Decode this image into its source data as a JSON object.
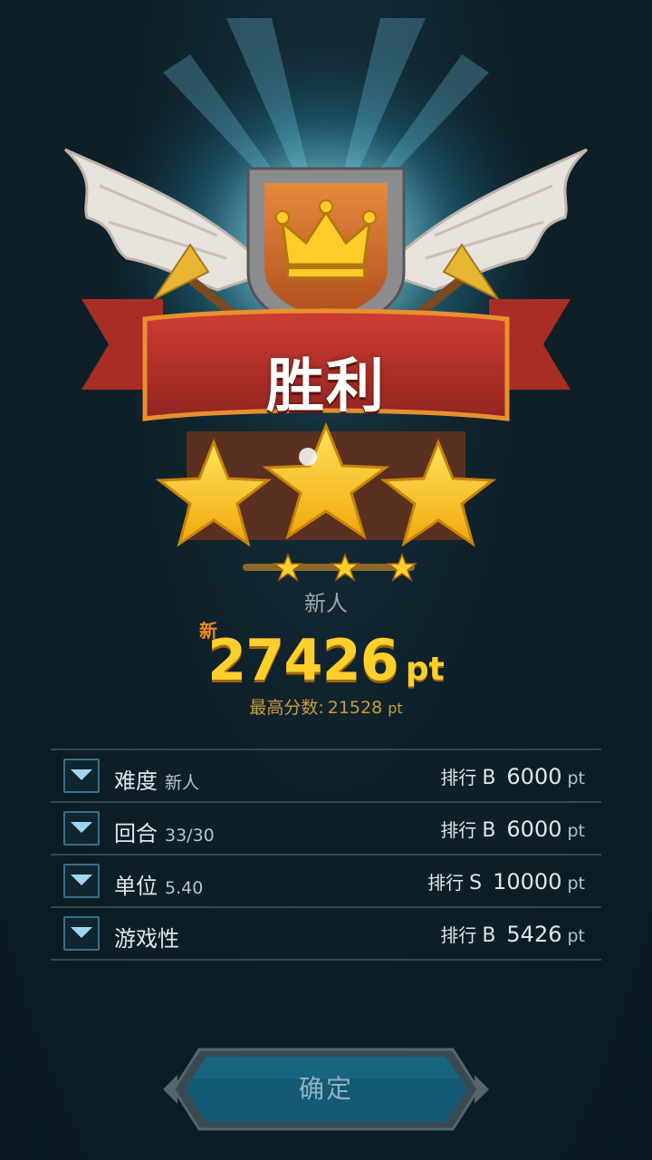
{
  "result": {
    "title": "胜利",
    "stars_earned": 3,
    "stars_total": 3,
    "rank_label": "新人"
  },
  "score": {
    "new_badge": "新",
    "value": "27426",
    "unit": "pt",
    "best_label": "最高分数:",
    "best_value": "21528",
    "best_unit": "pt"
  },
  "stats": [
    {
      "name": "难度",
      "detail": "新人",
      "rank_text": "排行",
      "grade": "B",
      "points": "6000",
      "unit": "pt"
    },
    {
      "name": "回合",
      "detail": "33/30",
      "rank_text": "排行",
      "grade": "B",
      "points": "6000",
      "unit": "pt"
    },
    {
      "name": "单位",
      "detail": "5.40",
      "rank_text": "排行",
      "grade": "S",
      "points": "10000",
      "unit": "pt"
    },
    {
      "name": "游戏性",
      "detail": "",
      "rank_text": "排行",
      "grade": "B",
      "points": "5426",
      "unit": "pt"
    }
  ],
  "confirm_label": "确定",
  "colors": {
    "background": "#0c1c24",
    "gold": "#ffcf2c",
    "ribbon": "#b5322a",
    "accent_orange": "#f08a1c",
    "divider": "#33474f",
    "button_border": "#3b6e86"
  },
  "icons": {
    "emblem": "crown-shield-emblem",
    "expand": "chevron-down-icon",
    "star": "star-icon"
  }
}
